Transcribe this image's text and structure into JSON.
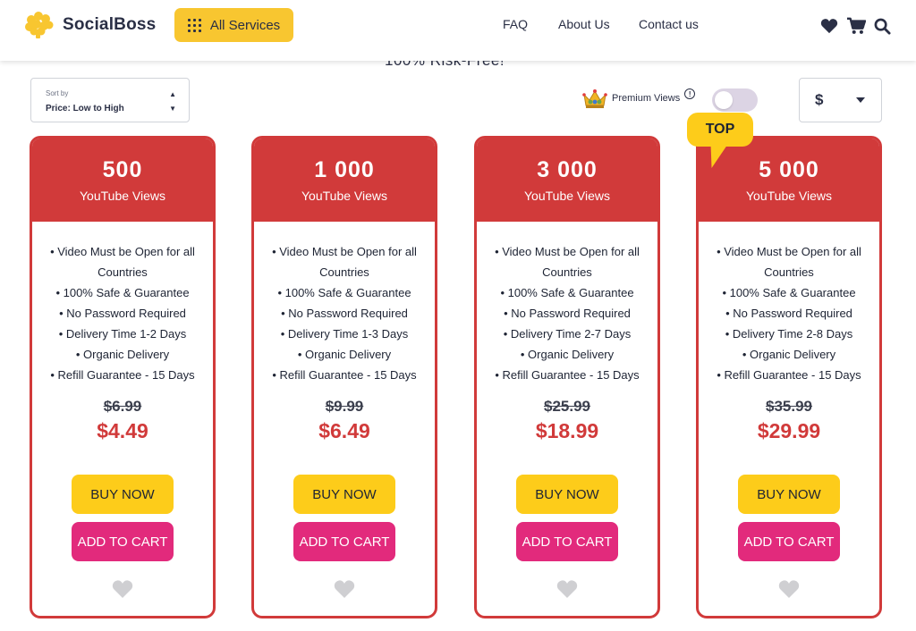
{
  "header": {
    "brand": "SocialBoss",
    "services_label": "All Services",
    "nav": [
      "FAQ",
      "About Us",
      "Contact us"
    ]
  },
  "subtitle": "100% Risk-Free!",
  "sort": {
    "label": "Sort by",
    "value": "Price: Low to High"
  },
  "premium": {
    "label": "Premium Views",
    "enabled": false
  },
  "currency": {
    "value": "$"
  },
  "top_badge": "TOP",
  "buttons": {
    "buy": "BUY NOW",
    "cart": "ADD TO CART"
  },
  "colors": {
    "accent_red": "#d13a3a",
    "yellow": "#fdcc1a",
    "pink": "#e22a7c"
  },
  "cards": [
    {
      "qty": "500",
      "unit": "YouTube Views",
      "features": [
        "• Video Must be Open for all Countries",
        "• 100% Safe & Guarantee",
        "• No Password Required",
        "• Delivery Time 1-2 Days",
        "• Organic Delivery",
        "• Refill Guarantee - 15 Days"
      ],
      "old_price": "$6.99",
      "price": "$4.49"
    },
    {
      "qty": "1 000",
      "unit": "YouTube Views",
      "features": [
        "• Video Must be Open for all Countries",
        "• 100% Safe & Guarantee",
        "• No Password Required",
        "• Delivery Time 1-3 Days",
        "• Organic Delivery",
        "• Refill Guarantee - 15 Days"
      ],
      "old_price": "$9.99",
      "price": "$6.49"
    },
    {
      "qty": "3 000",
      "unit": "YouTube Views",
      "features": [
        "• Video Must be Open for all Countries",
        "• 100% Safe & Guarantee",
        "• No Password Required",
        "• Delivery Time 2-7 Days",
        "• Organic Delivery",
        "• Refill Guarantee - 15 Days"
      ],
      "old_price": "$25.99",
      "price": "$18.99"
    },
    {
      "qty": "5 000",
      "unit": "YouTube Views",
      "features": [
        "• Video Must be Open for all Countries",
        "• 100% Safe & Guarantee",
        "• No Password Required",
        "• Delivery Time 2-8 Days",
        "• Organic Delivery",
        "• Refill Guarantee - 15 Days"
      ],
      "old_price": "$35.99",
      "price": "$29.99"
    }
  ]
}
